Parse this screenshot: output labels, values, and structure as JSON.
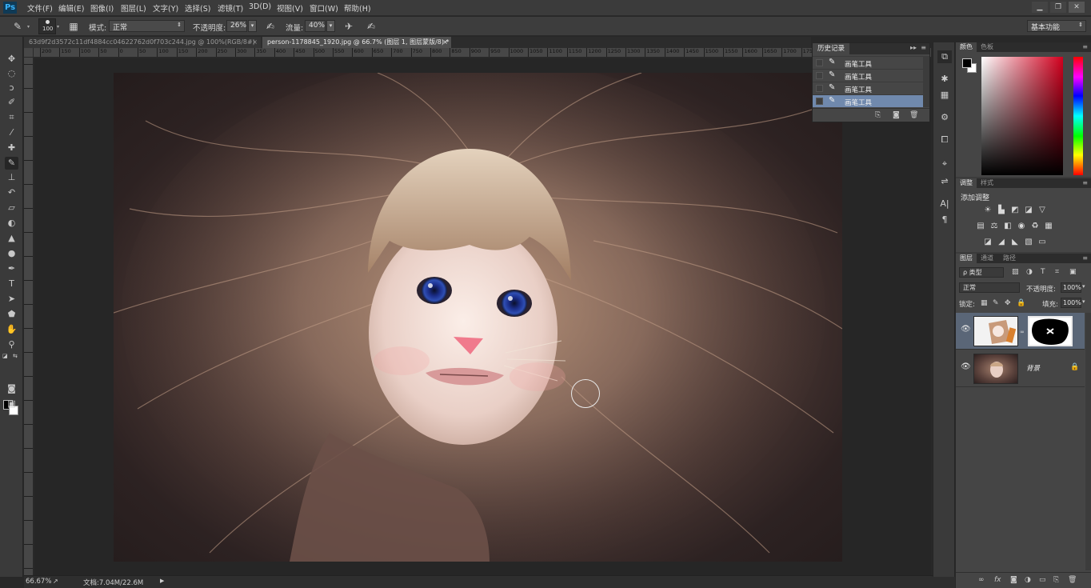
{
  "app": {
    "logo": "Ps",
    "menus": [
      "文件(F)",
      "编辑(E)",
      "图像(I)",
      "图层(L)",
      "文字(Y)",
      "选择(S)",
      "滤镜(T)",
      "3D(D)",
      "视图(V)",
      "窗口(W)",
      "帮助(H)"
    ],
    "window_controls": [
      "▁",
      "❐",
      "✕"
    ]
  },
  "options_bar": {
    "brush_size": "100",
    "mode_label": "模式:",
    "mode_value": "正常",
    "opacity_label": "不透明度:",
    "opacity_value": "26%",
    "flow_label": "流量:",
    "flow_value": "40%",
    "workspace": "基本功能"
  },
  "documents": [
    {
      "title": "63d9f2d3572c11df4884cc04622762d0f703c244.jpg @ 100%(RGB/8#)",
      "close": "×",
      "active": false
    },
    {
      "title": "person-1178845_1920.jpg @ 66.7% (图层 1, 图层蒙版/8) *",
      "close": "×",
      "active": true
    }
  ],
  "ruler": {
    "h_labels": [
      "200",
      "150",
      "100",
      "50",
      "0",
      "50",
      "100",
      "150",
      "200",
      "250",
      "300",
      "350",
      "400",
      "450",
      "500",
      "550",
      "600",
      "650",
      "700",
      "750",
      "800",
      "850",
      "900",
      "950",
      "1000",
      "1050",
      "1100",
      "1150",
      "1200",
      "1250",
      "1300",
      "1350",
      "1400",
      "1450",
      "1500",
      "1550",
      "1600",
      "1650",
      "1700",
      "1750",
      "1800",
      "1850",
      "1900",
      "1950",
      "2000"
    ]
  },
  "status": {
    "zoom": "66.67%",
    "doc_info": "文档:7.04M/22.6M"
  },
  "history": {
    "tab": "历史记录",
    "expand": "▸▸",
    "items": [
      "画笔工具",
      "画笔工具",
      "画笔工具",
      "画笔工具"
    ],
    "selected_index": 3
  },
  "color_panel": {
    "tabs": [
      "颜色",
      "色板"
    ],
    "foreground": "#000000",
    "background": "#ffffff"
  },
  "adjustments": {
    "tabs": [
      "调整",
      "样式"
    ],
    "title": "添加调整"
  },
  "layers": {
    "tabs": [
      "图层",
      "通道",
      "路径"
    ],
    "filter": "ρ 类型",
    "blend_mode": "正常",
    "opacity_label": "不透明度:",
    "opacity_value": "100%",
    "lock_label": "锁定:",
    "fill_label": "填充:",
    "fill_value": "100%",
    "items": [
      {
        "name": "",
        "selected": true,
        "has_mask": true
      },
      {
        "name": "背景",
        "selected": false,
        "locked": true
      }
    ]
  },
  "icons": {
    "menu_more": "≡"
  }
}
